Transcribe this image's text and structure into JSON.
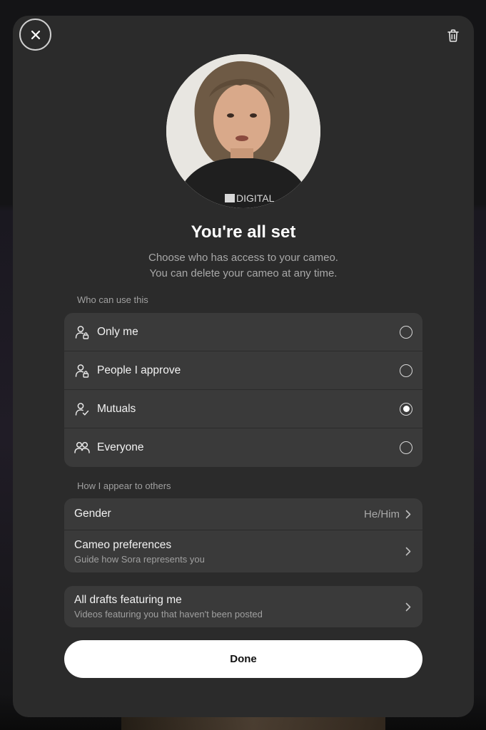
{
  "header": {
    "close_icon": "close-icon",
    "delete_icon": "trash-icon"
  },
  "avatar": {
    "shirt_text": "DIGITAL"
  },
  "title": "You're all set",
  "subtitle_line1": "Choose who has access to your cameo.",
  "subtitle_line2": "You can delete your cameo at any time.",
  "access": {
    "section_label": "Who can use this",
    "options": [
      {
        "label": "Only me",
        "icon": "person-lock-icon",
        "selected": false
      },
      {
        "label": "People I approve",
        "icon": "person-lock-icon",
        "selected": false
      },
      {
        "label": "Mutuals",
        "icon": "person-check-icon",
        "selected": true
      },
      {
        "label": "Everyone",
        "icon": "people-icon",
        "selected": false
      }
    ]
  },
  "appearance": {
    "section_label": "How I appear to others",
    "gender_label": "Gender",
    "gender_value": "He/Him",
    "prefs_label": "Cameo preferences",
    "prefs_sub": "Guide how Sora represents you"
  },
  "drafts": {
    "label": "All drafts featuring me",
    "sub": "Videos featuring you that haven't been posted"
  },
  "done_label": "Done",
  "colors": {
    "modal_bg": "#2b2b2b",
    "row_bg": "#3a3a3a",
    "button_bg": "#ffffff"
  }
}
